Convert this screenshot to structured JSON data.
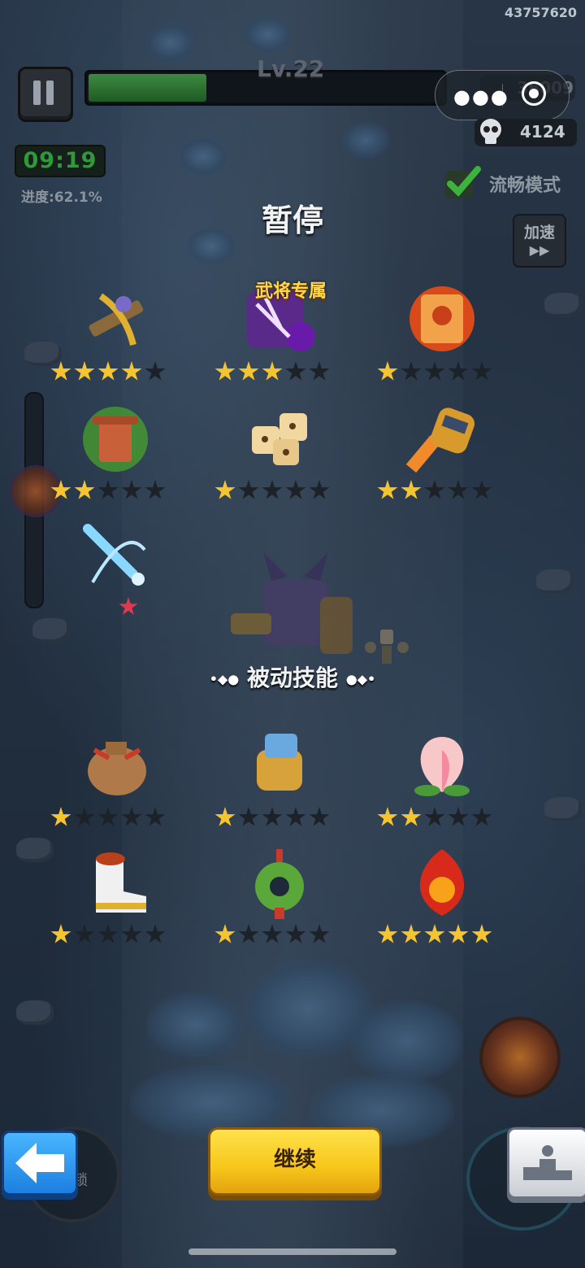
{
  "status": {
    "user_id": "43757620"
  },
  "hud": {
    "level": "Lv.22",
    "xp_fraction": 0.33,
    "coins": "36009",
    "kills": "4124",
    "timer": "09:19",
    "progress": "进度:62.1%",
    "smooth_mode": "流畅模式",
    "speed_label": "加速",
    "speed_arrow": "▶▶"
  },
  "pause": {
    "title": "暂停",
    "exclusive_tag": "武将专属",
    "passive_title": "被动技能",
    "continue_label": "继续"
  },
  "active_skills": [
    {
      "icon": "crossbow-icon",
      "stars": 4
    },
    {
      "icon": "purple-orb-icon",
      "stars": 3
    },
    {
      "icon": "fire-scroll-icon",
      "stars": 1
    },
    {
      "icon": "green-brazier-icon",
      "stars": 2
    },
    {
      "icon": "dice-icon",
      "stars": 1
    },
    {
      "icon": "rocket-fist-icon",
      "stars": 2
    },
    {
      "icon": "ice-sword-icon",
      "stars": 0,
      "special": "red-star"
    }
  ],
  "passive_skills": [
    {
      "icon": "sack-icon",
      "stars": 1
    },
    {
      "icon": "gauntlet-icon",
      "stars": 1
    },
    {
      "icon": "peach-icon",
      "stars": 2
    },
    {
      "icon": "boot-icon",
      "stars": 1
    },
    {
      "icon": "jade-coin-icon",
      "stars": 1
    },
    {
      "icon": "flame-orb-icon",
      "stars": 5
    }
  ],
  "colors": {
    "star_on": "#f5c431",
    "star_off": "#1d2228",
    "continue_bg": "#f7c61a",
    "back_bg": "#1c7fe0"
  }
}
